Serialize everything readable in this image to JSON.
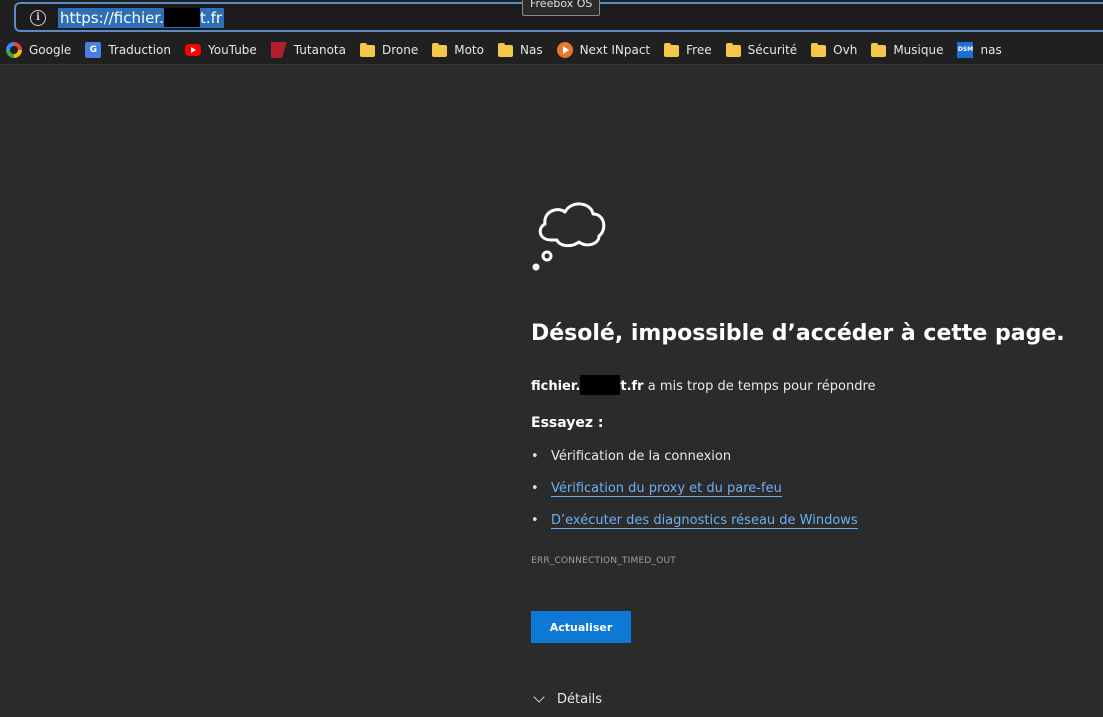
{
  "address_bar": {
    "url_prefix": "https://fichier.",
    "url_suffix": "t.fr",
    "tooltip": "Freebox OS",
    "info_icon": "info-icon"
  },
  "bookmarks": [
    {
      "label": "Google",
      "icon": "google-icon"
    },
    {
      "label": "Traduction",
      "icon": "translate-icon"
    },
    {
      "label": "YouTube",
      "icon": "youtube-icon"
    },
    {
      "label": "Tutanota",
      "icon": "tutanota-icon"
    },
    {
      "label": "Drone",
      "icon": "folder-icon"
    },
    {
      "label": "Moto",
      "icon": "folder-icon"
    },
    {
      "label": "Nas",
      "icon": "folder-icon"
    },
    {
      "label": "Next INpact",
      "icon": "nextinpact-icon"
    },
    {
      "label": "Free",
      "icon": "folder-icon"
    },
    {
      "label": "Sécurité",
      "icon": "folder-icon"
    },
    {
      "label": "Ovh",
      "icon": "folder-icon"
    },
    {
      "label": "Musique",
      "icon": "folder-icon"
    },
    {
      "label": "nas",
      "icon": "dsm-icon"
    }
  ],
  "icon_text": {
    "translate": "G",
    "dsm": "DSM",
    "info": "i"
  },
  "error_page": {
    "title": "Désolé, impossible d’accéder à cette page.",
    "host_prefix": "fichier.",
    "host_suffix": "t.fr",
    "message": " a mis trop de temps pour répondre",
    "try_label": "Essayez :",
    "suggestions": [
      {
        "text": "Vérification de la connexion",
        "link": false
      },
      {
        "text": "Vérification du proxy et du pare-feu",
        "link": true
      },
      {
        "text": "D’exécuter des diagnostics réseau de Windows",
        "link": true
      }
    ],
    "error_code": "ERR_CONNECTION_TIMED_OUT",
    "refresh_label": "Actualiser",
    "details_label": "Détails"
  },
  "colors": {
    "background": "#2b2b2b",
    "link": "#6ab0f3",
    "button": "#0e78d4",
    "folder": "#f5c84a"
  }
}
